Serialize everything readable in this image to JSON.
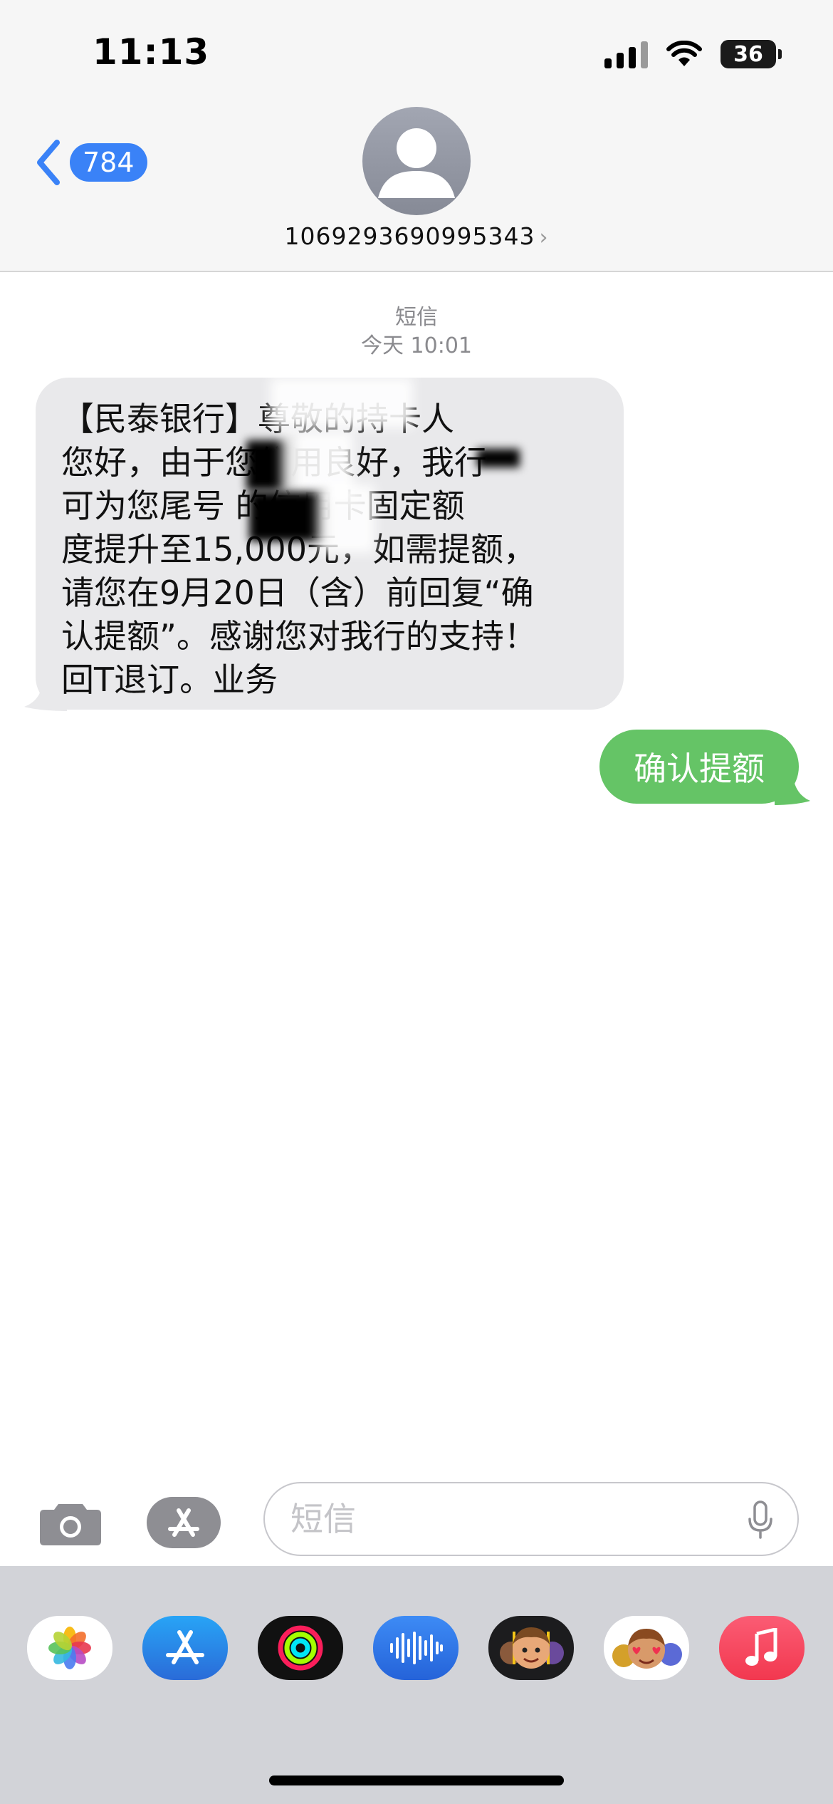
{
  "status_bar": {
    "time": "11:13",
    "battery": "36"
  },
  "header": {
    "back_count": "784",
    "contact_number": "1069293690995343",
    "chevron": "›"
  },
  "thread": {
    "service": "短信",
    "timestamp": "今天 10:01",
    "incoming": {
      "lines": [
        "【民泰银行】尊敬的持卡人",
        "您好，由于您信用良好，我行",
        "可为您尾号 的信用卡固定额",
        "度提升至15,000元，如需提额，",
        "请您在9月20日（含）前回复“确",
        "认提额”。感谢您对我行的支持！",
        "回T退订。业务"
      ]
    },
    "outgoing": {
      "text": "确认提额"
    }
  },
  "composer": {
    "placeholder": "短信"
  },
  "app_drawer": {
    "apps": [
      "photos-icon",
      "app-store-icon",
      "fitness-icon",
      "audio-message-icon",
      "memoji-stickers-icon",
      "animoji-icon",
      "music-icon"
    ]
  },
  "colors": {
    "incoming_bubble": "#e9e9eb",
    "outgoing_bubble": "#65c466",
    "accent_blue": "#3a82f7",
    "drawer_bg": "#d2d3d8"
  }
}
